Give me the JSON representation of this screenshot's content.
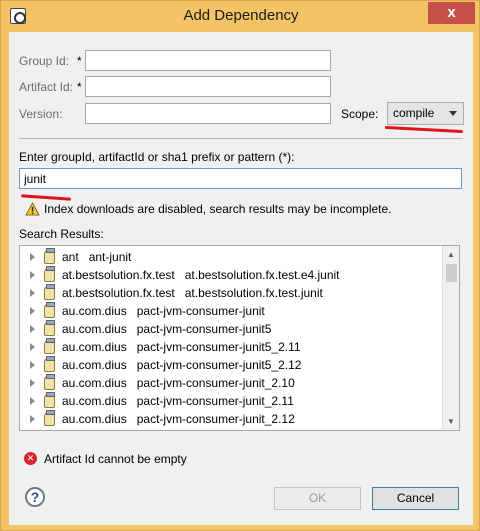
{
  "window": {
    "title": "Add Dependency",
    "close_glyph": "x"
  },
  "form": {
    "group_id_label": "Group Id:",
    "artifact_id_label": "Artifact Id:",
    "version_label": "Version:",
    "required_marker": "*",
    "group_id_value": "",
    "artifact_id_value": "",
    "version_value": "",
    "scope_label": "Scope:",
    "scope_value": "compile"
  },
  "search": {
    "prompt": "Enter groupId, artifactId or sha1 prefix or pattern (*):",
    "query": "junit",
    "warning": "Index downloads are disabled, search results may be incomplete.",
    "results_label": "Search Results:",
    "results": [
      {
        "group": "ant",
        "artifact": "ant-junit"
      },
      {
        "group": "at.bestsolution.fx.test",
        "artifact": "at.bestsolution.fx.test.e4.junit"
      },
      {
        "group": "at.bestsolution.fx.test",
        "artifact": "at.bestsolution.fx.test.junit"
      },
      {
        "group": "au.com.dius",
        "artifact": "pact-jvm-consumer-junit"
      },
      {
        "group": "au.com.dius",
        "artifact": "pact-jvm-consumer-junit5"
      },
      {
        "group": "au.com.dius",
        "artifact": "pact-jvm-consumer-junit5_2.11"
      },
      {
        "group": "au.com.dius",
        "artifact": "pact-jvm-consumer-junit5_2.12"
      },
      {
        "group": "au.com.dius",
        "artifact": "pact-jvm-consumer-junit_2.10"
      },
      {
        "group": "au.com.dius",
        "artifact": "pact-jvm-consumer-junit_2.11"
      },
      {
        "group": "au.com.dius",
        "artifact": "pact-jvm-consumer-junit_2.12"
      }
    ]
  },
  "status": {
    "error": "Artifact Id cannot be empty"
  },
  "buttons": {
    "help": "?",
    "ok": "OK",
    "cancel": "Cancel"
  },
  "icons": {
    "app": "dialog-app-icon",
    "warning": "warning-icon",
    "error": "error-icon",
    "jar": "jar-icon",
    "expander": "tree-expander-icon",
    "help": "help-icon"
  },
  "colors": {
    "annotation_red": "#e0121c",
    "title_bar": "#f3c466",
    "close": "#c7504a"
  }
}
